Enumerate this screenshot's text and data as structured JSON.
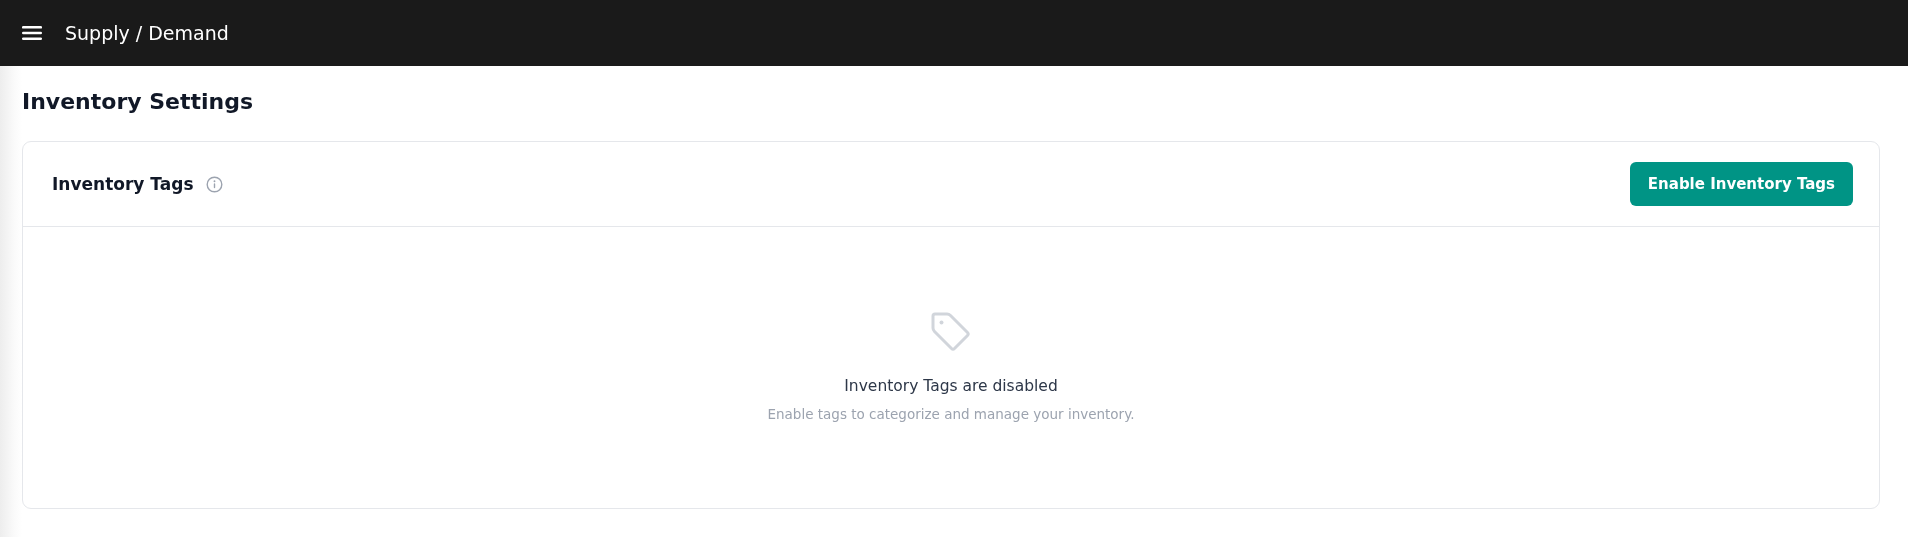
{
  "app_bar": {
    "title": "Supply / Demand"
  },
  "page_title": "Inventory Settings",
  "card": {
    "title": "Inventory Tags",
    "button": "Enable Inventory Tags",
    "empty_state": {
      "title": "Inventory Tags are disabled",
      "message": "Enable tags to categorize and manage your inventory."
    }
  }
}
